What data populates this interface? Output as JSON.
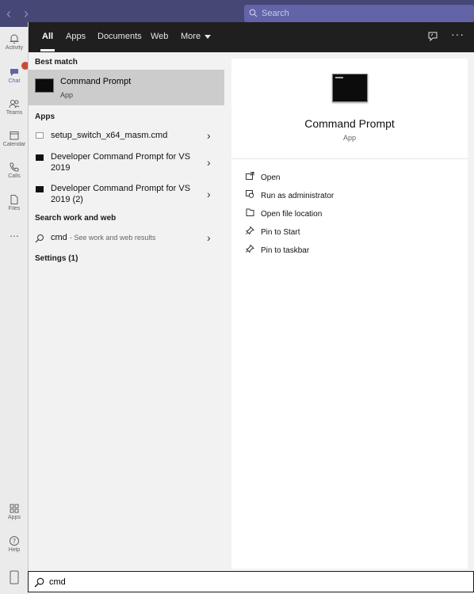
{
  "teams": {
    "search_placeholder": "Search",
    "rail": [
      {
        "label": "Activity",
        "icon": "bell-icon"
      },
      {
        "label": "Chat",
        "icon": "chat-icon"
      },
      {
        "label": "Teams",
        "icon": "teams-icon"
      },
      {
        "label": "Calendar",
        "icon": "calendar-icon"
      },
      {
        "label": "Calls",
        "icon": "phone-icon"
      },
      {
        "label": "Files",
        "icon": "file-icon"
      },
      {
        "label": "...",
        "icon": "more-icon"
      },
      {
        "label": "Apps",
        "icon": "apps-icon"
      },
      {
        "label": "Help",
        "icon": "help-icon"
      }
    ]
  },
  "tabs": [
    {
      "label": "All",
      "active": true
    },
    {
      "label": "Apps"
    },
    {
      "label": "Documents"
    },
    {
      "label": "Web"
    },
    {
      "label": "More"
    }
  ],
  "left": {
    "best_match_header": "Best match",
    "best_match": {
      "title": "Command Prompt",
      "subtitle": "App"
    },
    "apps_header": "Apps",
    "apps": [
      {
        "name": "setup_switch_x64_masm.cmd"
      },
      {
        "name": "Developer Command Prompt for VS 2019"
      },
      {
        "name": "Developer Command Prompt for VS 2019 (2)"
      }
    ],
    "web_header": "Search work and web",
    "web_query": "cmd",
    "web_hint": "- See work and web results",
    "settings_header": "Settings (1)"
  },
  "right": {
    "title": "Command Prompt",
    "subtitle": "App",
    "actions": [
      {
        "label": "Open",
        "icon": "open-icon"
      },
      {
        "label": "Run as administrator",
        "icon": "shield-icon"
      },
      {
        "label": "Open file location",
        "icon": "folder-icon"
      },
      {
        "label": "Pin to Start",
        "icon": "pin-icon"
      },
      {
        "label": "Pin to taskbar",
        "icon": "pin-icon"
      }
    ]
  },
  "search": {
    "value": "cmd"
  }
}
